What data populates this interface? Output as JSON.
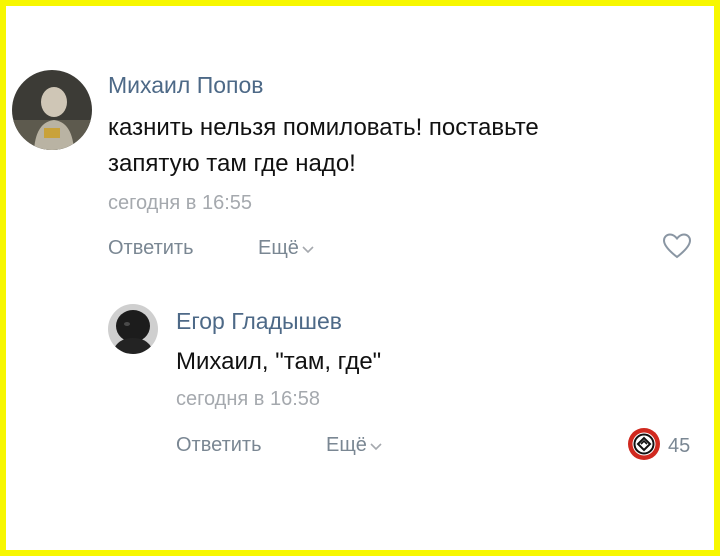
{
  "comments": [
    {
      "author": "Михаил Попов",
      "text_line1": "казнить нельзя помиловать! поставьте",
      "text_line2": "запятую там где надо!",
      "time": "сегодня в 16:55",
      "reply_label": "Ответить",
      "more_label": "Ещё"
    },
    {
      "author": "Егор Гладышев",
      "text": "Михаил, \"там, где\"",
      "time": "сегодня в 16:58",
      "reply_label": "Ответить",
      "more_label": "Ещё",
      "reaction_count": "45"
    }
  ],
  "colors": {
    "frame": "#f7f700",
    "author": "#4d6987",
    "meta": "#a5a9ae",
    "action": "#7a8793",
    "reaction_red": "#d0291f"
  }
}
